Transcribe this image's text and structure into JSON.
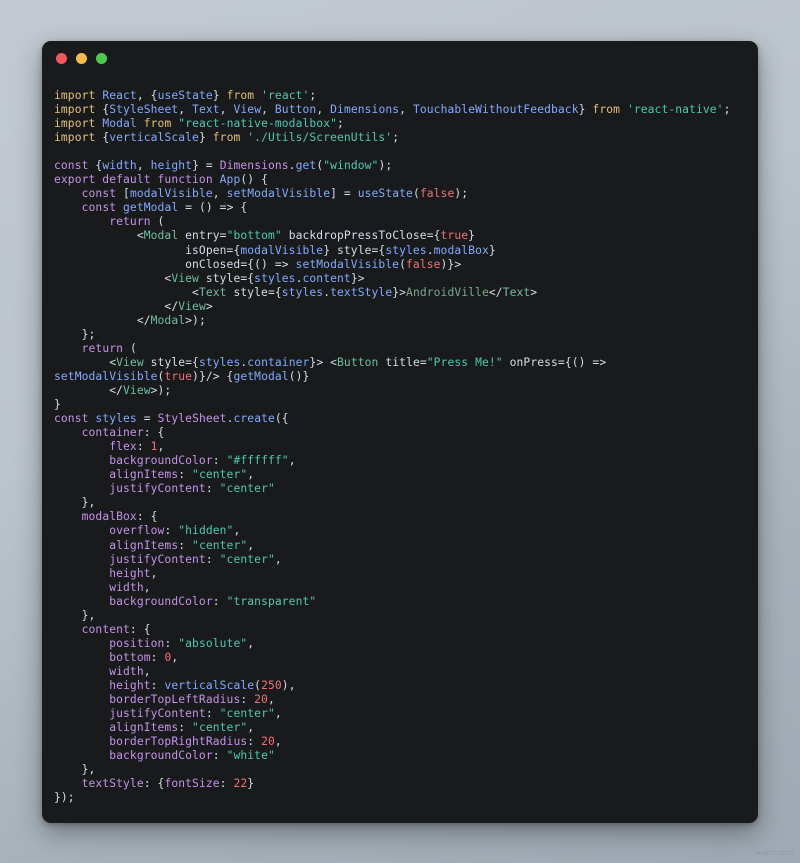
{
  "window": {
    "background_color": "#bcc4cc",
    "panel_color": "#181a1b",
    "traffic_lights": [
      {
        "name": "close",
        "color": "#f0585c"
      },
      {
        "name": "minimize",
        "color": "#f5bd4f"
      },
      {
        "name": "maximize",
        "color": "#4ec94e"
      }
    ]
  },
  "watermark": {
    "text": "woktr.com"
  },
  "editor": {
    "language": "javascript-jsx",
    "palette": {
      "keyword": "#c792ea",
      "import": "#e5c07b",
      "variable": "#82aaff",
      "string": "#4ec9b0",
      "number": "#f07178",
      "tag": "#6fbfa0",
      "plain": "#d6deeb",
      "punctuation": "#89ddff"
    },
    "lines": [
      "import React, {useState} from 'react';",
      "import {StyleSheet, Text, View, Button, Dimensions, TouchableWithoutFeedback} from 'react-native';",
      "import Modal from \"react-native-modalbox\";",
      "import {verticalScale} from './Utils/ScreenUtils';",
      "",
      "const {width, height} = Dimensions.get(\"window\");",
      "export default function App() {",
      "    const [modalVisible, setModalVisible] = useState(false);",
      "    const getModal = () => {",
      "        return (",
      "            <Modal entry=\"bottom\" backdropPressToClose={true}",
      "                   isOpen={modalVisible} style={styles.modalBox}",
      "                   onClosed={() => setModalVisible(false)}>",
      "                <View style={styles.content}>",
      "                    <Text style={styles.textStyle}>AndroidVille</Text>",
      "                </View>",
      "            </Modal>);",
      "    };",
      "    return (",
      "        <View style={styles.container}> <Button title=\"Press Me!\" onPress={() =>",
      "setModalVisible(true)}/> {getModal()}",
      "        </View>);",
      "}",
      "const styles = StyleSheet.create({",
      "    container: {",
      "        flex: 1,",
      "        backgroundColor: \"#ffffff\",",
      "        alignItems: \"center\",",
      "        justifyContent: \"center\"",
      "    },",
      "    modalBox: {",
      "        overflow: \"hidden\",",
      "        alignItems: \"center\",",
      "        justifyContent: \"center\",",
      "        height,",
      "        width,",
      "        backgroundColor: \"transparent\"",
      "    },",
      "    content: {",
      "        position: \"absolute\",",
      "        bottom: 0,",
      "        width,",
      "        height: verticalScale(250),",
      "        borderTopLeftRadius: 20,",
      "        justifyContent: \"center\",",
      "        alignItems: \"center\",",
      "        borderTopRightRadius: 20,",
      "        backgroundColor: \"white\"",
      "    },",
      "    textStyle: {fontSize: 22}",
      "});"
    ],
    "highlighted_html": "<span class=\"ln\"><span class=\"t-imp\">import</span> <span class=\"t-var\">React</span><span class=\"t-plain\">, {</span><span class=\"t-var\">useState</span><span class=\"t-plain\">}</span> <span class=\"t-imp\">from</span> <span class=\"t-str\">'react'</span><span class=\"t-plain\">;</span></span><span class=\"ln\"><span class=\"t-imp\">import</span> <span class=\"t-plain\">{</span><span class=\"t-var\">StyleSheet</span><span class=\"t-plain\">, </span><span class=\"t-var\">Text</span><span class=\"t-plain\">, </span><span class=\"t-var\">View</span><span class=\"t-plain\">, </span><span class=\"t-var\">Button</span><span class=\"t-plain\">, </span><span class=\"t-var\">Dimensions</span><span class=\"t-plain\">, </span><span class=\"t-var\">TouchableWithoutFeedback</span><span class=\"t-plain\">}</span> <span class=\"t-imp\">from</span> <span class=\"t-str\">'react-native'</span><span class=\"t-plain\">;</span></span><span class=\"ln\"><span class=\"t-imp\">import</span> <span class=\"t-var\">Modal</span> <span class=\"t-imp\">from</span> <span class=\"t-str\">\"react-native-modalbox\"</span><span class=\"t-plain\">;</span></span><span class=\"ln\"><span class=\"t-imp\">import</span> <span class=\"t-plain\">{</span><span class=\"t-var\">verticalScale</span><span class=\"t-plain\">}</span> <span class=\"t-imp\">from</span> <span class=\"t-str\">'./Utils/ScreenUtils'</span><span class=\"t-plain\">;</span></span><span class=\"ln\"> </span><span class=\"ln\"><span class=\"t-kw\">const</span> <span class=\"t-plain\">{</span><span class=\"t-var\">width</span><span class=\"t-plain\">, </span><span class=\"t-var\">height</span><span class=\"t-plain\">} = </span><span class=\"t-class\">Dimensions</span><span class=\"t-plain\">.</span><span class=\"t-fn\">get</span><span class=\"t-plain\">(</span><span class=\"t-str\">\"window\"</span><span class=\"t-plain\">);</span></span><span class=\"ln\"><span class=\"t-kw\">export default function</span> <span class=\"t-fn\">App</span><span class=\"t-plain\">() {</span></span><span class=\"ln\"><span class=\"t-plain\">    </span><span class=\"t-kw\">const</span> <span class=\"t-plain\">[</span><span class=\"t-var\">modalVisible</span><span class=\"t-plain\">, </span><span class=\"t-var\">setModalVisible</span><span class=\"t-plain\">] = </span><span class=\"t-fn\">useState</span><span class=\"t-plain\">(</span><span class=\"t-num\">false</span><span class=\"t-plain\">);</span></span><span class=\"ln\"><span class=\"t-plain\">    </span><span class=\"t-kw\">const</span> <span class=\"t-fn\">getModal</span> <span class=\"t-plain\">= () =&gt; {</span></span><span class=\"ln\"><span class=\"t-plain\">        </span><span class=\"t-kw\">return</span> <span class=\"t-plain\">(</span></span><span class=\"ln\"><span class=\"t-plain\">            &lt;</span><span class=\"t-tag\">Modal</span> <span class=\"t-attr\">entry</span><span class=\"t-plain\">=</span><span class=\"t-str\">\"bottom\"</span> <span class=\"t-attr\">backdropPressToClose</span><span class=\"t-plain\">={</span><span class=\"t-num\">true</span><span class=\"t-plain\">}</span></span><span class=\"ln\"><span class=\"t-plain\">                   </span><span class=\"t-attr\">isOpen</span><span class=\"t-plain\">={</span><span class=\"t-var\">modalVisible</span><span class=\"t-plain\">} </span><span class=\"t-attr\">style</span><span class=\"t-plain\">={</span><span class=\"t-var\">styles</span><span class=\"t-plain\">.</span><span class=\"t-var\">modalBox</span><span class=\"t-plain\">}</span></span><span class=\"ln\"><span class=\"t-plain\">                   </span><span class=\"t-attr\">onClosed</span><span class=\"t-plain\">={() =&gt; </span><span class=\"t-fn\">setModalVisible</span><span class=\"t-plain\">(</span><span class=\"t-num\">false</span><span class=\"t-plain\">)}&gt;</span></span><span class=\"ln\"><span class=\"t-plain\">                </span><span class=\"t-plain\">&lt;</span><span class=\"t-tag\">View</span> <span class=\"t-attr\">style</span><span class=\"t-plain\">={</span><span class=\"t-var\">styles</span><span class=\"t-plain\">.</span><span class=\"t-var\">content</span><span class=\"t-plain\">}&gt;</span></span><span class=\"ln\"><span class=\"t-plain\">                    &lt;</span><span class=\"t-tag\">Text</span> <span class=\"t-attr\">style</span><span class=\"t-plain\">={</span><span class=\"t-var\">styles</span><span class=\"t-plain\">.</span><span class=\"t-var\">textStyle</span><span class=\"t-plain\">}&gt;</span><span class=\"t-text\">AndroidVille</span><span class=\"t-plain\">&lt;/</span><span class=\"t-tag\">Text</span><span class=\"t-plain\">&gt;</span></span><span class=\"ln\"><span class=\"t-plain\">                &lt;/</span><span class=\"t-tag\">View</span><span class=\"t-plain\">&gt;</span></span><span class=\"ln\"><span class=\"t-plain\">            &lt;/</span><span class=\"t-tag\">Modal</span><span class=\"t-plain\">&gt;);</span></span><span class=\"ln\"><span class=\"t-plain\">    };</span></span><span class=\"ln\"><span class=\"t-plain\">    </span><span class=\"t-kw\">return</span> <span class=\"t-plain\">(</span></span><span class=\"ln\"><span class=\"t-plain\">        &lt;</span><span class=\"t-tag\">View</span> <span class=\"t-attr\">style</span><span class=\"t-plain\">={</span><span class=\"t-var\">styles</span><span class=\"t-plain\">.</span><span class=\"t-var\">container</span><span class=\"t-plain\">}&gt; &lt;</span><span class=\"t-tag\">Button</span> <span class=\"t-attr\">title</span><span class=\"t-plain\">=</span><span class=\"t-str\">\"Press Me!\"</span> <span class=\"t-attr\">onPress</span><span class=\"t-plain\">={() =&gt;</span></span><span class=\"ln\"><span class=\"t-fn\">setModalVisible</span><span class=\"t-plain\">(</span><span class=\"t-num\">true</span><span class=\"t-plain\">)}/&gt; {</span><span class=\"t-fn\">getModal</span><span class=\"t-plain\">()}</span></span><span class=\"ln\"><span class=\"t-plain\">        &lt;/</span><span class=\"t-tag\">View</span><span class=\"t-plain\">&gt;);</span></span><span class=\"ln\"><span class=\"t-plain\">}</span></span><span class=\"ln\"><span class=\"t-kw\">const</span> <span class=\"t-var\">styles</span> <span class=\"t-plain\">= </span><span class=\"t-class\">StyleSheet</span><span class=\"t-plain\">.</span><span class=\"t-fn\">create</span><span class=\"t-plain\">({</span></span><span class=\"ln\"><span class=\"t-plain\">    </span><span class=\"t-prop\">container</span><span class=\"t-plain\">: {</span></span><span class=\"ln\"><span class=\"t-plain\">        </span><span class=\"t-prop\">flex</span><span class=\"t-plain\">: </span><span class=\"t-num\">1</span><span class=\"t-plain\">,</span></span><span class=\"ln\"><span class=\"t-plain\">        </span><span class=\"t-prop\">backgroundColor</span><span class=\"t-plain\">: </span><span class=\"t-str\">\"#ffffff\"</span><span class=\"t-plain\">,</span></span><span class=\"ln\"><span class=\"t-plain\">        </span><span class=\"t-prop\">alignItems</span><span class=\"t-plain\">: </span><span class=\"t-str\">\"center\"</span><span class=\"t-plain\">,</span></span><span class=\"ln\"><span class=\"t-plain\">        </span><span class=\"t-prop\">justifyContent</span><span class=\"t-plain\">: </span><span class=\"t-str\">\"center\"</span></span><span class=\"ln\"><span class=\"t-plain\">    },</span></span><span class=\"ln\"><span class=\"t-plain\">    </span><span class=\"t-prop\">modalBox</span><span class=\"t-plain\">: {</span></span><span class=\"ln\"><span class=\"t-plain\">        </span><span class=\"t-prop\">overflow</span><span class=\"t-plain\">: </span><span class=\"t-str\">\"hidden\"</span><span class=\"t-plain\">,</span></span><span class=\"ln\"><span class=\"t-plain\">        </span><span class=\"t-prop\">alignItems</span><span class=\"t-plain\">: </span><span class=\"t-str\">\"center\"</span><span class=\"t-plain\">,</span></span><span class=\"ln\"><span class=\"t-plain\">        </span><span class=\"t-prop\">justifyContent</span><span class=\"t-plain\">: </span><span class=\"t-str\">\"center\"</span><span class=\"t-plain\">,</span></span><span class=\"ln\"><span class=\"t-plain\">        </span><span class=\"t-prop\">height</span><span class=\"t-plain\">,</span></span><span class=\"ln\"><span class=\"t-plain\">        </span><span class=\"t-prop\">width</span><span class=\"t-plain\">,</span></span><span class=\"ln\"><span class=\"t-plain\">        </span><span class=\"t-prop\">backgroundColor</span><span class=\"t-plain\">: </span><span class=\"t-str\">\"transparent\"</span></span><span class=\"ln\"><span class=\"t-plain\">    },</span></span><span class=\"ln\"><span class=\"t-plain\">    </span><span class=\"t-prop\">content</span><span class=\"t-plain\">: {</span></span><span class=\"ln\"><span class=\"t-plain\">        </span><span class=\"t-prop\">position</span><span class=\"t-plain\">: </span><span class=\"t-str\">\"absolute\"</span><span class=\"t-plain\">,</span></span><span class=\"ln\"><span class=\"t-plain\">        </span><span class=\"t-prop\">bottom</span><span class=\"t-plain\">: </span><span class=\"t-num\">0</span><span class=\"t-plain\">,</span></span><span class=\"ln\"><span class=\"t-plain\">        </span><span class=\"t-prop\">width</span><span class=\"t-plain\">,</span></span><span class=\"ln\"><span class=\"t-plain\">        </span><span class=\"t-prop\">height</span><span class=\"t-plain\">: </span><span class=\"t-fn\">verticalScale</span><span class=\"t-plain\">(</span><span class=\"t-num\">250</span><span class=\"t-plain\">),</span></span><span class=\"ln\"><span class=\"t-plain\">        </span><span class=\"t-prop\">borderTopLeftRadius</span><span class=\"t-plain\">: </span><span class=\"t-num\">20</span><span class=\"t-plain\">,</span></span><span class=\"ln\"><span class=\"t-plain\">        </span><span class=\"t-prop\">justifyContent</span><span class=\"t-plain\">: </span><span class=\"t-str\">\"center\"</span><span class=\"t-plain\">,</span></span><span class=\"ln\"><span class=\"t-plain\">        </span><span class=\"t-prop\">alignItems</span><span class=\"t-plain\">: </span><span class=\"t-str\">\"center\"</span><span class=\"t-plain\">,</span></span><span class=\"ln\"><span class=\"t-plain\">        </span><span class=\"t-prop\">borderTopRightRadius</span><span class=\"t-plain\">: </span><span class=\"t-num\">20</span><span class=\"t-plain\">,</span></span><span class=\"ln\"><span class=\"t-plain\">        </span><span class=\"t-prop\">backgroundColor</span><span class=\"t-plain\">: </span><span class=\"t-str\">\"white\"</span></span><span class=\"ln\"><span class=\"t-plain\">    },</span></span><span class=\"ln\"><span class=\"t-plain\">    </span><span class=\"t-prop\">textStyle</span><span class=\"t-plain\">: {</span><span class=\"t-prop\">fontSize</span><span class=\"t-plain\">: </span><span class=\"t-num\">22</span><span class=\"t-plain\">}</span></span><span class=\"ln\"><span class=\"t-plain\">});</span></span>"
  }
}
